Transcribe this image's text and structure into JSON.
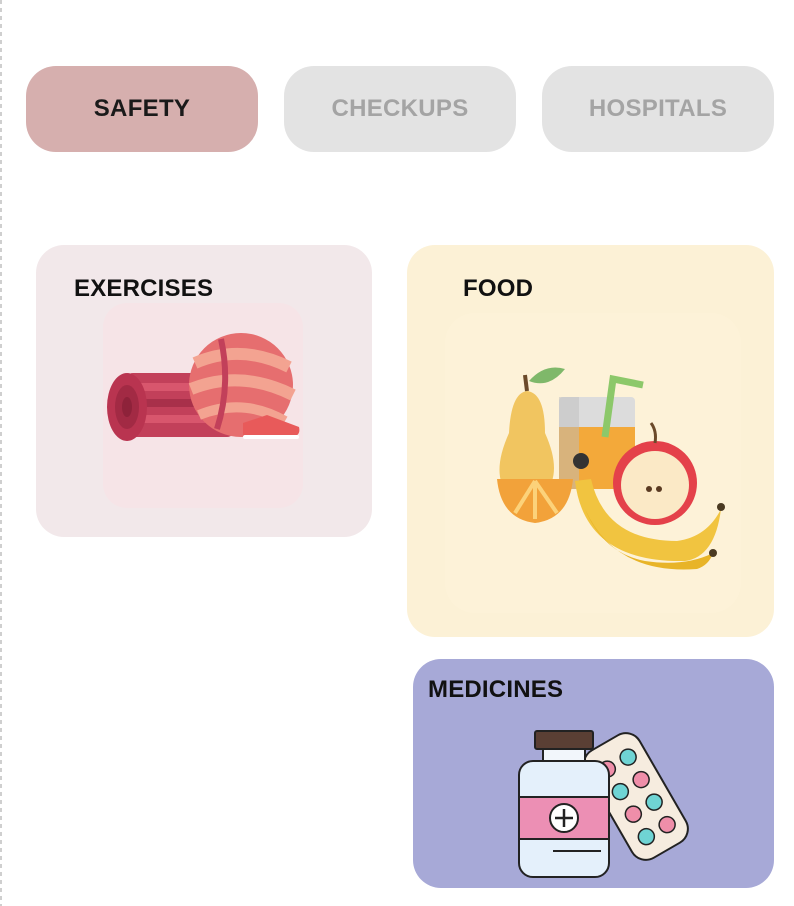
{
  "tabs": [
    {
      "label": "SAFETY",
      "active": true
    },
    {
      "label": "CHECKUPS",
      "active": false
    },
    {
      "label": "HOSPITALS",
      "active": false
    }
  ],
  "cards": {
    "exercises": {
      "title": "EXERCISES",
      "color": "#f2e8ea",
      "icon": "yoga-mat-ball-icon"
    },
    "food": {
      "title": "FOOD",
      "color": "#fcf1d6",
      "icon": "fruit-juice-icon"
    },
    "medicines": {
      "title": "MEDICINES",
      "color": "#a7a9d7",
      "icon": "medicine-bottle-pills-icon"
    }
  },
  "colors": {
    "tab_active": "#d6afae",
    "tab_inactive": "#e3e3e3",
    "tab_inactive_text": "#a4a4a4"
  }
}
